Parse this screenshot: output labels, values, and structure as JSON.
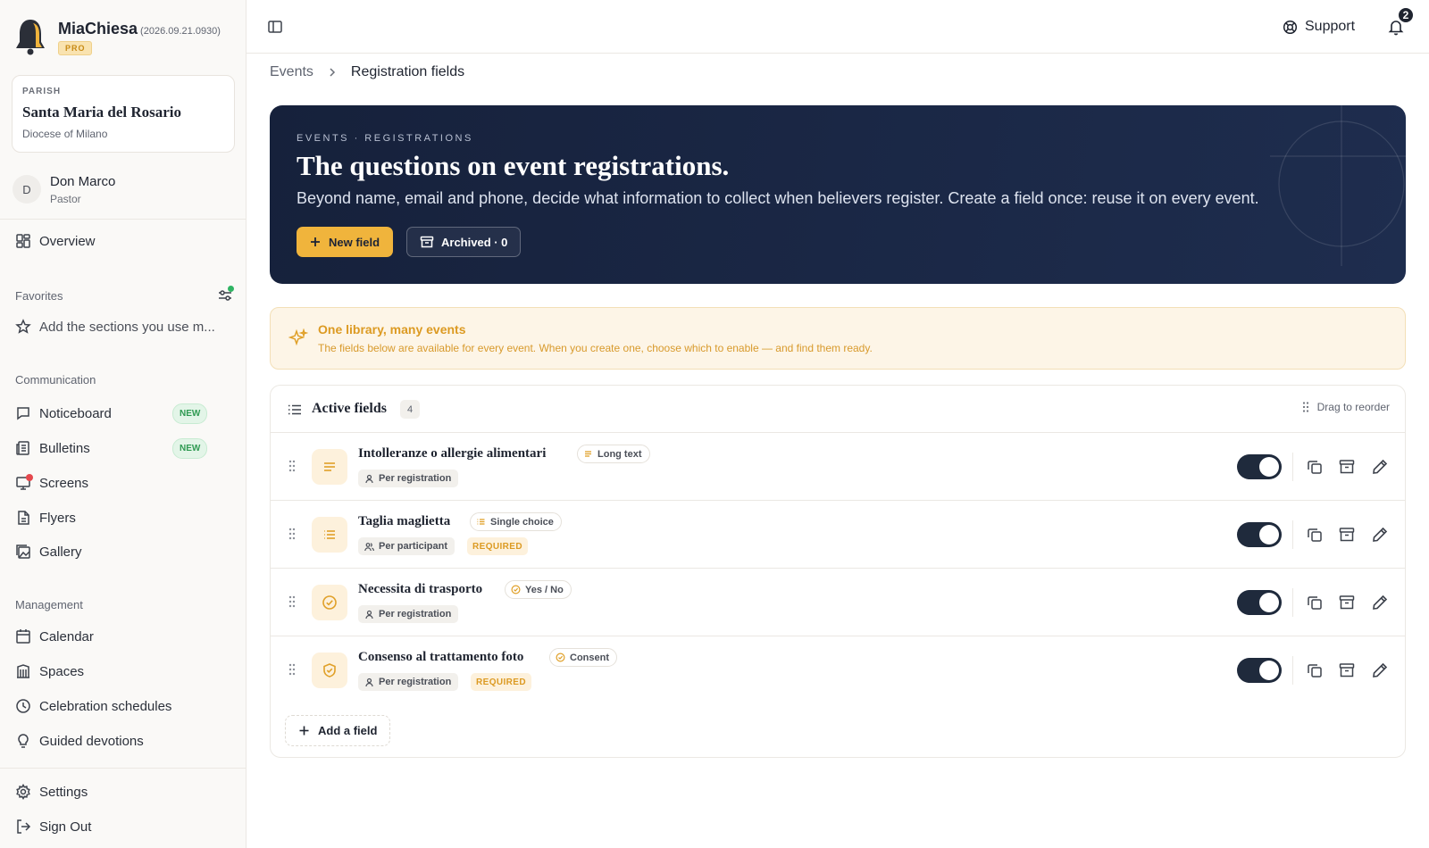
{
  "brand": {
    "name": "MiaChiesa",
    "version": "(2026.09.21.0930)",
    "plan": "PRO"
  },
  "parish": {
    "label": "PARISH",
    "name": "Santa Maria del Rosario",
    "diocese": "Diocese of Milano"
  },
  "user": {
    "initial": "D",
    "name": "Don Marco",
    "role": "Pastor"
  },
  "nav": {
    "overview": "Overview",
    "favorites_header": "Favorites",
    "favorites_hint": "Add the sections you use m...",
    "communication_header": "Communication",
    "communication": [
      {
        "label": "Noticeboard",
        "badge": "NEW"
      },
      {
        "label": "Bulletins",
        "badge": "NEW"
      },
      {
        "label": "Screens"
      },
      {
        "label": "Flyers"
      },
      {
        "label": "Gallery"
      }
    ],
    "management_header": "Management",
    "management": [
      {
        "label": "Calendar"
      },
      {
        "label": "Spaces"
      },
      {
        "label": "Celebration schedules"
      },
      {
        "label": "Guided devotions"
      }
    ],
    "settings": "Settings",
    "sign_out": "Sign Out"
  },
  "topbar": {
    "support": "Support",
    "notifications": "2"
  },
  "breadcrumb": {
    "parent": "Events",
    "current": "Registration fields"
  },
  "hero": {
    "eyebrow": "EVENTS · REGISTRATIONS",
    "title": "The questions on event registrations.",
    "description": "Beyond name, email and phone, decide what information to collect when believers register. Create a field once: reuse it on every event.",
    "new_button": "New field",
    "archived_button": "Archived · 0"
  },
  "tip": {
    "title": "One library, many events",
    "text": "The fields below are available for every event. When you create one, choose which to enable — and find them ready."
  },
  "fields_panel": {
    "title": "Active fields",
    "count": "4",
    "drag_hint": "Drag to reorder",
    "add_button": "Add a field",
    "rows": [
      {
        "name": "Intolleranze o allergie alimentari",
        "type": "Long text",
        "type_icon": "lines-icon",
        "scope": "Per registration",
        "required": "",
        "enabled": true
      },
      {
        "name": "Taglia maglietta",
        "type": "Single choice",
        "type_icon": "list-icon",
        "scope": "Per participant",
        "required": "REQUIRED",
        "enabled": true
      },
      {
        "name": "Necessita di trasporto",
        "type": "Yes / No",
        "type_icon": "check-circle-icon",
        "scope": "Per registration",
        "required": "",
        "enabled": true
      },
      {
        "name": "Consenso al trattamento foto",
        "type": "Consent",
        "type_icon": "shield-check-icon",
        "scope": "Per registration",
        "required": "REQUIRED",
        "enabled": true
      }
    ]
  },
  "colors": {
    "accent": "#f0b43c",
    "hero_bg": "#16213b",
    "tip_bg": "#fdf5e7",
    "toggle_on": "#1f2a3c",
    "new_badge": "#2f9a52"
  }
}
